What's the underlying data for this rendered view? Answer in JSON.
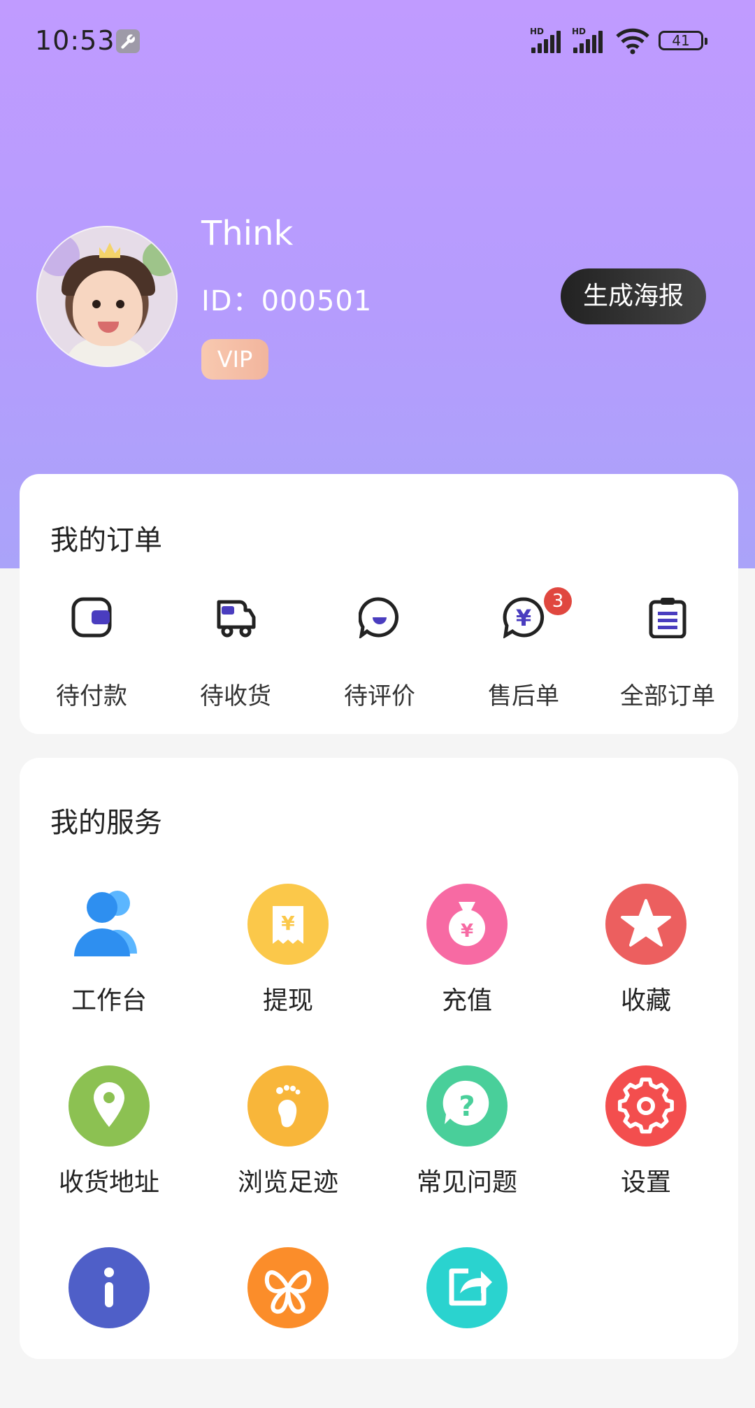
{
  "status_bar": {
    "time": "10:53",
    "battery": "41",
    "hd1": "HD",
    "hd2": "HD"
  },
  "profile": {
    "name": "Think",
    "id_text": "ID：000501",
    "vip_label": "VIP",
    "poster_button": "生成海报"
  },
  "orders": {
    "title": "我的订单",
    "items": [
      {
        "label": "待付款",
        "icon": "wallet-icon"
      },
      {
        "label": "待收货",
        "icon": "truck-icon"
      },
      {
        "label": "待评价",
        "icon": "review-icon"
      },
      {
        "label": "售后单",
        "icon": "refund-icon",
        "badge": "3"
      },
      {
        "label": "全部订单",
        "icon": "clipboard-icon"
      }
    ]
  },
  "services": {
    "title": "我的服务",
    "items": [
      {
        "label": "工作台",
        "icon": "team-icon",
        "color": "#3a9ff5"
      },
      {
        "label": "提现",
        "icon": "withdraw-icon",
        "color": "#fbc84a"
      },
      {
        "label": "充值",
        "icon": "money-bag-icon",
        "color": "#f76aa3"
      },
      {
        "label": "收藏",
        "icon": "star-icon",
        "color": "#ec5f5f"
      },
      {
        "label": "收货地址",
        "icon": "location-icon",
        "color": "#8cc152"
      },
      {
        "label": "浏览足迹",
        "icon": "footprint-icon",
        "color": "#f8b63a"
      },
      {
        "label": "常见问题",
        "icon": "question-icon",
        "color": "#49cf9a"
      },
      {
        "label": "设置",
        "icon": "gear-icon",
        "color": "#f34e4e"
      },
      {
        "label": "",
        "icon": "info-icon",
        "color": "#4f5fc8"
      },
      {
        "label": "",
        "icon": "butterfly-icon",
        "color": "#fb8d2a"
      },
      {
        "label": "",
        "icon": "share-icon",
        "color": "#2ad3cf"
      }
    ]
  }
}
